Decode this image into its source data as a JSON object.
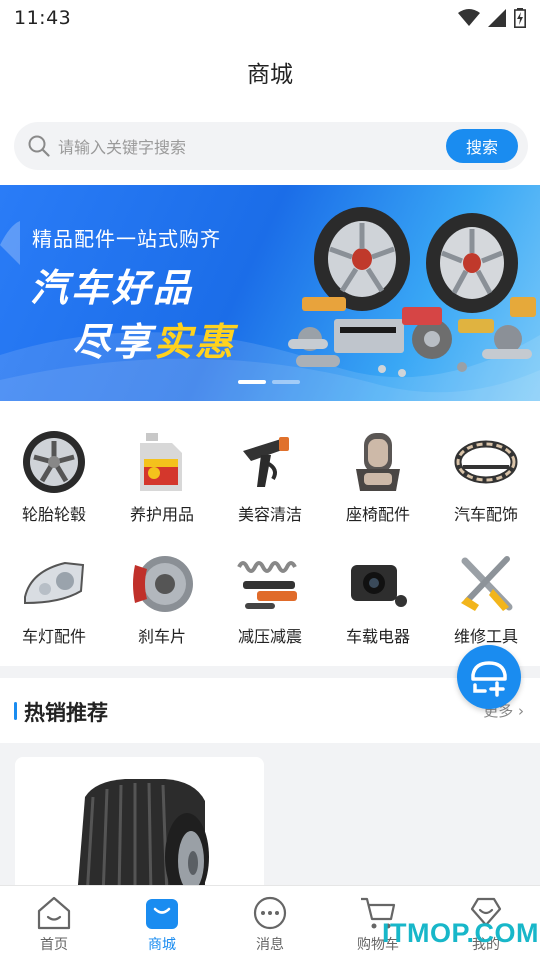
{
  "status_bar": {
    "time": "11:43"
  },
  "header": {
    "title": "商城"
  },
  "search": {
    "placeholder": "请输入关键字搜索",
    "button_label": "搜索"
  },
  "banner": {
    "subtitle": "精品配件一站式购齐",
    "title_line1": "汽车好品",
    "title_line2_white": "尽享",
    "title_line2_yellow": "实惠",
    "slides_count": 2,
    "active_slide": 1
  },
  "categories": [
    {
      "label": "轮胎轮毂",
      "icon": "wheel-rim-icon"
    },
    {
      "label": "养护用品",
      "icon": "oil-bottle-icon"
    },
    {
      "label": "美容清洁",
      "icon": "spray-gun-icon"
    },
    {
      "label": "座椅配件",
      "icon": "car-seat-icon"
    },
    {
      "label": "汽车配饰",
      "icon": "steering-cover-icon"
    },
    {
      "label": "车灯配件",
      "icon": "headlight-icon"
    },
    {
      "label": "刹车片",
      "icon": "brake-disc-icon"
    },
    {
      "label": "减压减震",
      "icon": "shock-absorber-icon"
    },
    {
      "label": "车载电器",
      "icon": "dashcam-icon"
    },
    {
      "label": "维修工具",
      "icon": "repair-tools-icon"
    }
  ],
  "hot": {
    "title": "热销推荐",
    "more_label": "更多"
  },
  "bottom_nav": [
    {
      "label": "首页",
      "icon": "home-icon",
      "active": false
    },
    {
      "label": "商城",
      "icon": "shopping-bag-icon",
      "active": true
    },
    {
      "label": "消息",
      "icon": "message-icon",
      "active": false
    },
    {
      "label": "购物车",
      "icon": "cart-icon",
      "active": false
    },
    {
      "label": "我的",
      "icon": "profile-diamond-icon",
      "active": false
    }
  ],
  "watermark": "ITMOP.COM",
  "colors": {
    "accent": "#1a8cf0",
    "banner_yellow": "#ffd21e",
    "watermark": "#18b7c9"
  }
}
